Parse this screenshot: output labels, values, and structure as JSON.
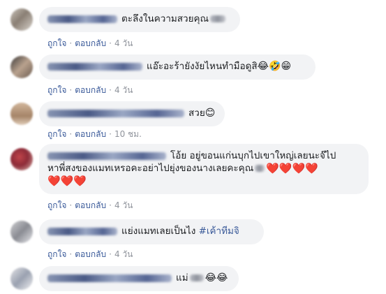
{
  "comments": [
    {
      "text": "ตะลึงในความสวยคุณ",
      "emojis": "",
      "actions": {
        "like": "ถูกใจ",
        "reply": "ตอบกลับ",
        "time": "4 วัน"
      }
    },
    {
      "text": "แอ๊ะอะร้ายังงัยไหนทำมือดูสิ",
      "emojis": "😂🤣😁",
      "actions": {
        "like": "ถูกใจ",
        "reply": "ตอบกลับ",
        "time": "4 วัน"
      }
    },
    {
      "text": "สวย",
      "emojis": "😊",
      "actions": {
        "like": "ถูกใจ",
        "reply": "ตอบกลับ",
        "time": "10 ชม."
      }
    },
    {
      "text_line1": "โอ้ย อยู่ขอนแก่นบุกไปเขาใหญ่เลยนะจ๊ไป",
      "text_line2": "หาพี่สงของแมทเหรอคะอย่าไปยุ่งของนางเลยคะคุณ",
      "hearts_line2": "❤️❤️❤️❤️",
      "hearts_line3": "❤️❤️❤️",
      "actions": {
        "like": "ถูกใจ",
        "reply": "ตอบกลับ",
        "time": "4 วัน"
      }
    },
    {
      "text": "แย่งแมทเลยเป็นไง",
      "hashtag": "#เค้าทีมจิ",
      "actions": {
        "like": "ถูกใจ",
        "reply": "ตอบกลับ",
        "time": "4 วัน"
      }
    },
    {
      "text": "แม่",
      "emojis": "😂😂"
    }
  ],
  "colors": {
    "bubble_bg": "#f2f3f5",
    "link": "#385898",
    "meta": "#90949c",
    "hashtag": "#385898",
    "heart": "#e0245e"
  }
}
